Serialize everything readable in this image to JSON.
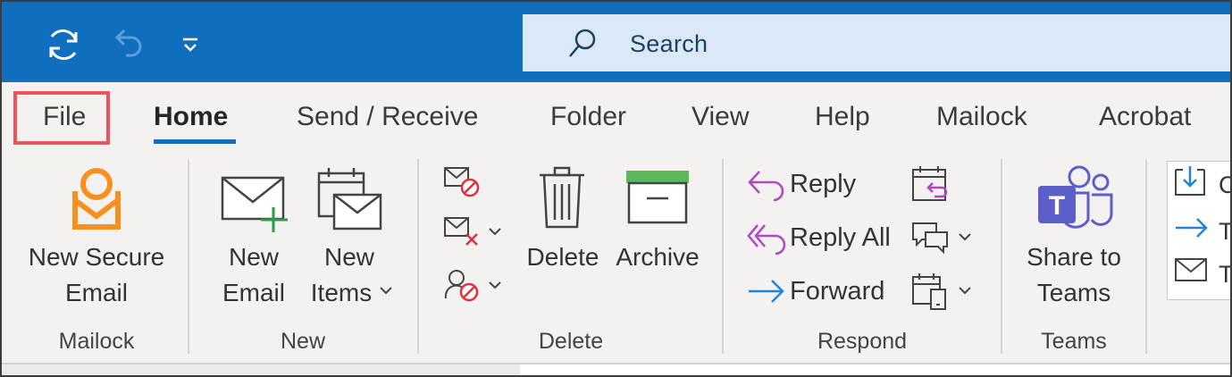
{
  "titlebar": {
    "search_placeholder": "Search",
    "quick_access": [
      "sync-icon",
      "undo-icon",
      "customize-quick-access-icon"
    ],
    "colors": {
      "bar": "#106ebe",
      "search_bg": "#dbe9f7"
    }
  },
  "tabs": [
    {
      "label": "File",
      "highlighted": true
    },
    {
      "label": "Home",
      "active": true
    },
    {
      "label": "Send / Receive"
    },
    {
      "label": "Folder"
    },
    {
      "label": "View"
    },
    {
      "label": "Help"
    },
    {
      "label": "Mailock"
    },
    {
      "label": "Acrobat"
    }
  ],
  "groups": {
    "mailock": {
      "label": "Mailock",
      "new_secure_email": [
        "New Secure",
        "Email"
      ]
    },
    "new": {
      "label": "New",
      "new_email": [
        "New",
        "Email"
      ],
      "new_items": [
        "New",
        "Items"
      ]
    },
    "delete": {
      "label": "Delete",
      "delete": "Delete",
      "archive": "Archive"
    },
    "respond": {
      "label": "Respond",
      "reply": "Reply",
      "reply_all": "Reply All",
      "forward": "Forward"
    },
    "teams": {
      "label": "Teams",
      "share_to_teams": [
        "Share to",
        "Teams"
      ]
    },
    "quick_steps": {
      "items": [
        "C",
        "T",
        "T"
      ]
    }
  },
  "colors": {
    "accent": "#106ebe",
    "highlight_box": "#e8555a",
    "reply_purple": "#b146c2",
    "forward_blue": "#1f86d6",
    "mailock_orange": "#f7901e",
    "block_red": "#e0303c",
    "archive_green": "#5cb85c",
    "teams_purple": "#5b5fc7"
  }
}
